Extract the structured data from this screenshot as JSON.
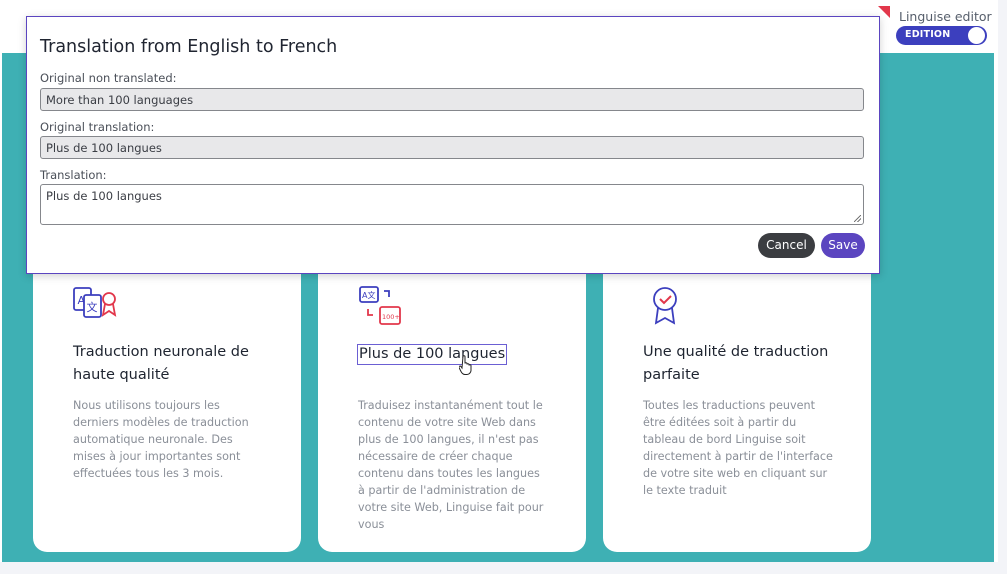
{
  "editor": {
    "label": "Linguise editor",
    "toggle_label": "EDITION",
    "toggle_on": true
  },
  "modal": {
    "title": "Translation from English to French",
    "original_label": "Original non translated:",
    "original_value": "More than 100 languages",
    "orig_translation_label": "Original translation:",
    "orig_translation_value": "Plus de 100 langues",
    "translation_label": "Translation:",
    "translation_value": "Plus de 100 langues",
    "cancel_label": "Cancel",
    "save_label": "Save"
  },
  "cards": [
    {
      "icon": "translate-certified-icon",
      "title": "Traduction neuronale de haute qualité",
      "desc": "Nous utilisons toujours les derniers modèles de traduction automatique neuronale. Des mises à jour importantes sont effectuées tous les 3 mois."
    },
    {
      "icon": "translate-100-icon",
      "title": "Plus de 100 langues",
      "desc": "Traduisez instantanément tout le contenu de votre site Web dans plus de 100 langues, il n'est pas nécessaire de créer chaque contenu dans toutes les langues à partir de l'administration de votre site Web, Linguise fait pour vous"
    },
    {
      "icon": "quality-badge-icon",
      "title": "Une qualité de traduction parfaite",
      "desc": "Toutes les traductions peuvent être éditées soit à partir du tableau de bord Linguise soit directement à partir de l'interface de votre site web en cliquant sur le texte traduit"
    }
  ],
  "icon_badge_text": "100+",
  "colors": {
    "teal": "#3eb0b4",
    "accent": "#5b45c0",
    "toggle": "#3c3fbe",
    "icon_red": "#e2374b"
  }
}
